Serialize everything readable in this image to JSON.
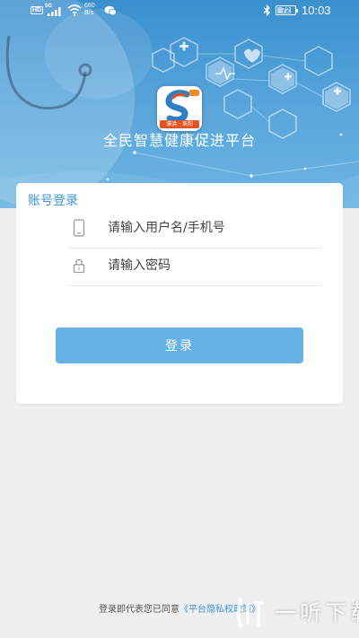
{
  "status_bar": {
    "hd": "HD",
    "signal_label": "5G",
    "net_speed_value": "660",
    "net_speed_unit": "B/s",
    "battery_level": "72",
    "time": "10:03",
    "icons": [
      "signal-icon",
      "wifi-icon",
      "message-icon",
      "bluetooth-icon",
      "battery-icon"
    ]
  },
  "header": {
    "logo_caption": "濮洪 · 阜阳",
    "title": "全民智慧健康促进平台"
  },
  "login": {
    "section_title": "账号登录",
    "username_placeholder": "请输入用户名/手机号",
    "password_placeholder": "请输入密码",
    "submit_label": "登录"
  },
  "footer": {
    "agreement_prefix": "登录即代表您已同意",
    "privacy_link": "《平台隐私权政策》"
  },
  "watermark": {
    "text": "一听下载"
  },
  "colors": {
    "banner": "#3a8fcf",
    "accent": "#3d95d7",
    "button": "#66b1e6",
    "background": "#efefef"
  }
}
